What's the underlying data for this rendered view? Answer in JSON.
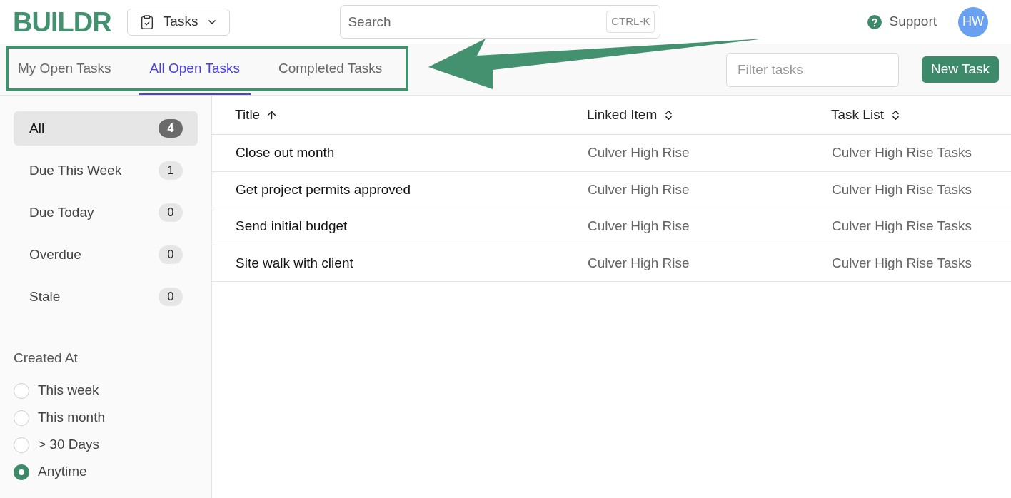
{
  "header": {
    "logo": "BUILDR",
    "module": {
      "label": "Tasks"
    },
    "search": {
      "placeholder": "Search",
      "shortcut": "CTRL-K"
    },
    "support": "Support",
    "avatar": "HW"
  },
  "tabs": [
    {
      "label": "My Open Tasks",
      "selected": false
    },
    {
      "label": "All Open Tasks",
      "selected": true
    },
    {
      "label": "Completed Tasks",
      "selected": false
    }
  ],
  "filter": {
    "placeholder": "Filter tasks"
  },
  "new_task_button": "New Task",
  "sidebar": {
    "items": [
      {
        "label": "All",
        "count": "4",
        "selected": true
      },
      {
        "label": "Due This Week",
        "count": "1",
        "selected": false
      },
      {
        "label": "Due Today",
        "count": "0",
        "selected": false
      },
      {
        "label": "Overdue",
        "count": "0",
        "selected": false
      },
      {
        "label": "Stale",
        "count": "0",
        "selected": false
      }
    ],
    "created_at": {
      "heading": "Created At",
      "options": [
        {
          "label": "This week",
          "selected": false
        },
        {
          "label": "This month",
          "selected": false
        },
        {
          "label": "> 30 Days",
          "selected": false
        },
        {
          "label": "Anytime",
          "selected": true
        }
      ]
    }
  },
  "table": {
    "columns": [
      {
        "label": "Title",
        "sorted_ascending": true
      },
      {
        "label": "Linked Item",
        "sorted_ascending": false
      },
      {
        "label": "Task List",
        "sorted_ascending": false
      }
    ],
    "rows": [
      [
        "Close out month",
        "Culver High Rise",
        "Culver High Rise Tasks"
      ],
      [
        "Get project permits approved",
        "Culver High Rise",
        "Culver High Rise Tasks"
      ],
      [
        "Send initial budget",
        "Culver High Rise",
        "Culver High Rise Tasks"
      ],
      [
        "Site walk with client",
        "Culver High Rise",
        "Culver High Rise Tasks"
      ]
    ]
  }
}
